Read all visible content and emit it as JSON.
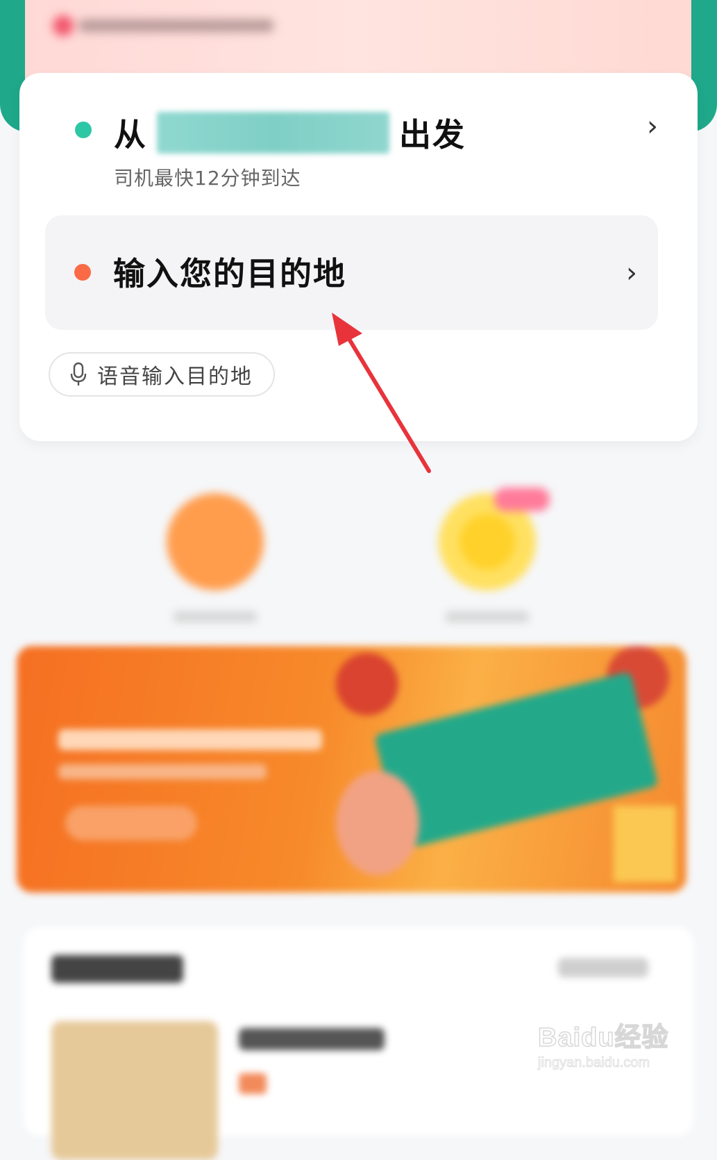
{
  "route": {
    "origin_prefix": "从",
    "origin_suffix": "出发",
    "eta_text": "司机最快12分钟到达",
    "destination_placeholder": "输入您的目的地",
    "voice_input_label": "语音输入目的地"
  },
  "icons": {
    "origin_dot": "green-dot-icon",
    "destination_dot": "orange-dot-icon",
    "chevron": "chevron-right-icon",
    "mic": "microphone-icon"
  },
  "colors": {
    "brand_green": "#1fa88a",
    "origin_dot": "#2ec7a5",
    "destination_dot": "#fa6a46",
    "annotation_arrow": "#e8333b"
  },
  "watermark": {
    "logo": "Baidu经验",
    "url": "jingyan.baidu.com"
  }
}
